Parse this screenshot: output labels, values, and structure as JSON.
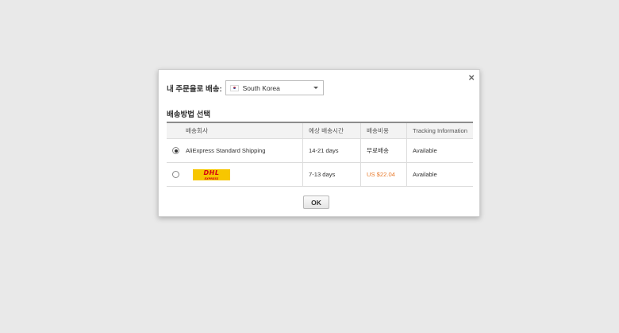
{
  "dialog": {
    "close_label": "×",
    "ship_to_label": "내 주문을로 배송:",
    "country_select": {
      "value": "South Korea",
      "flag_icon": "south-korea-flag-icon"
    },
    "section_title": "배송방법 선택",
    "table": {
      "headers": [
        "배송회사",
        "예상 배송시간",
        "배송비용",
        "Tracking Information"
      ],
      "rows": [
        {
          "selected": true,
          "company": "AliExpress Standard Shipping",
          "time": "14-21 days",
          "cost": "무료배송",
          "tracking": "Available"
        },
        {
          "selected": false,
          "company_logo": "DHL",
          "company_logo_sub": "EXPRESS",
          "time": "7-13 days",
          "cost": "US $22.04",
          "cost_color": "#e87a2c",
          "tracking": "Available"
        }
      ]
    },
    "ok_label": "OK"
  }
}
